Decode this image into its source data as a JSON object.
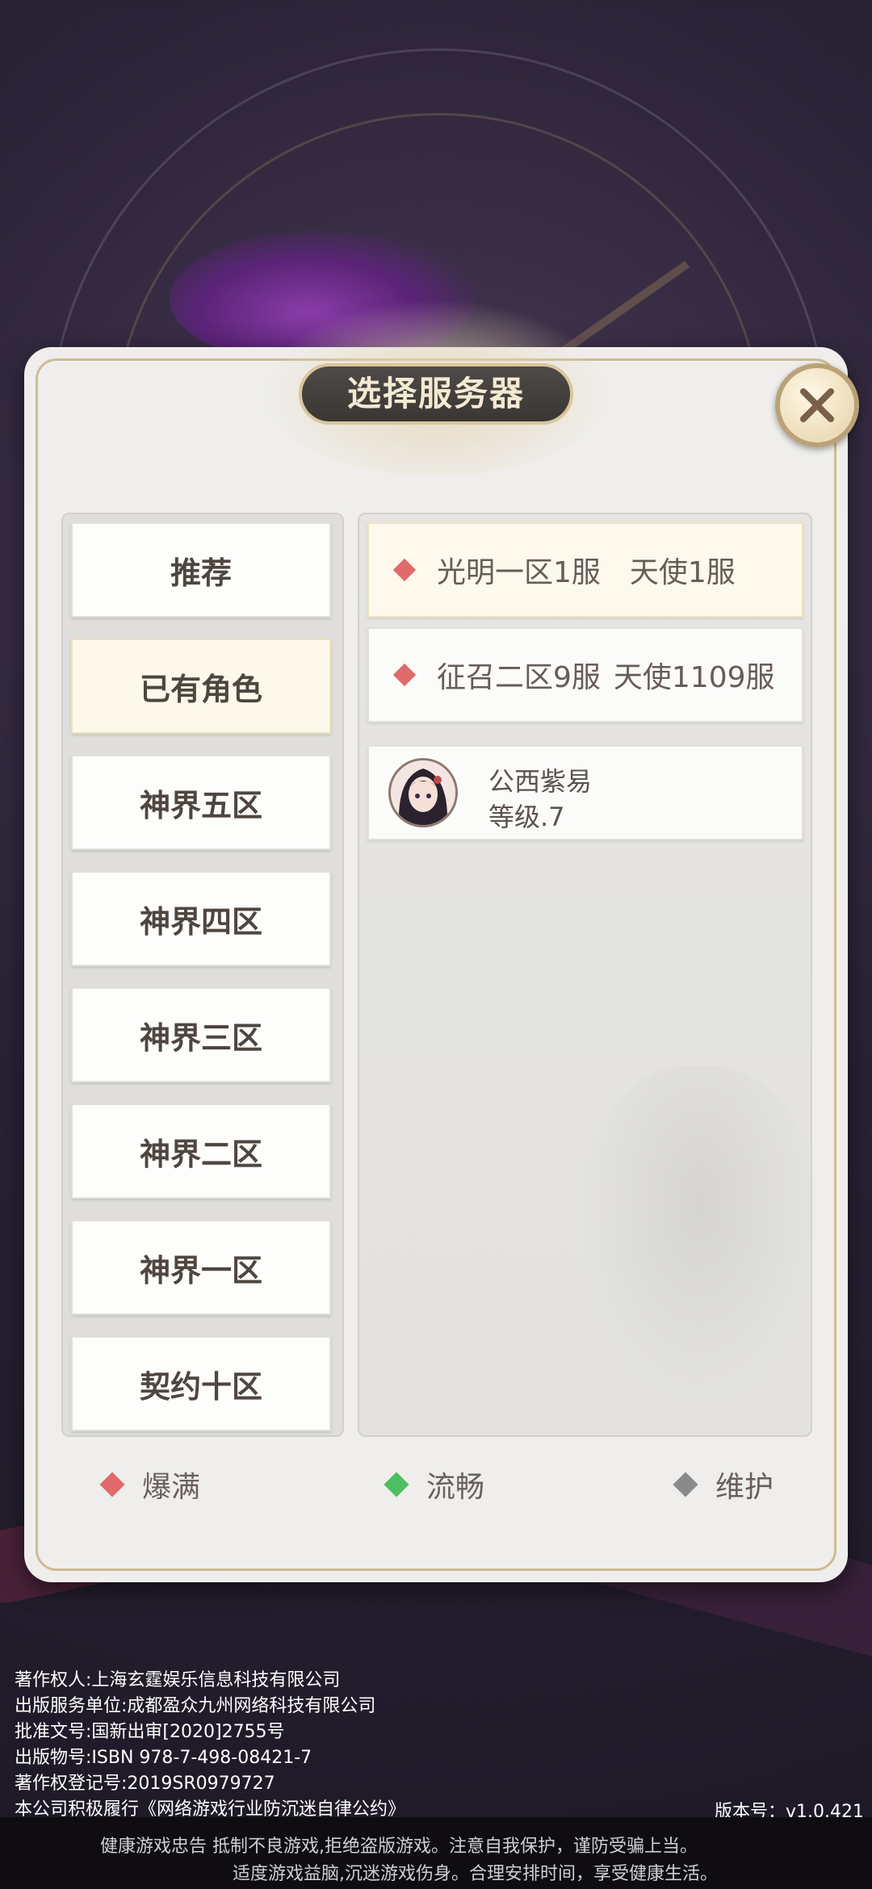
{
  "dialog": {
    "title": "选择服务器"
  },
  "regions": [
    {
      "label": "推荐",
      "selected": false
    },
    {
      "label": "已有角色",
      "selected": true
    },
    {
      "label": "神界五区",
      "selected": false
    },
    {
      "label": "神界四区",
      "selected": false
    },
    {
      "label": "神界三区",
      "selected": false
    },
    {
      "label": "神界二区",
      "selected": false
    },
    {
      "label": "神界一区",
      "selected": false
    },
    {
      "label": "契约十区",
      "selected": false
    }
  ],
  "servers": [
    {
      "name": "光明一区1服",
      "sub": "天使1服",
      "status": "爆满"
    },
    {
      "name": "征召二区9服",
      "sub": "天使1109服",
      "status": "爆满"
    }
  ],
  "character": {
    "name": "公西紫易",
    "level": "等级.7"
  },
  "legend": [
    {
      "label": "爆满",
      "color": "#e06a6c"
    },
    {
      "label": "流畅",
      "color": "#4cbf63"
    },
    {
      "label": "维护",
      "color": "#8a8a8a"
    }
  ],
  "footer": {
    "copyright_lines": [
      "著作权人:上海玄霆娱乐信息科技有限公司",
      "出版服务单位:成都盈众九州网络科技有限公司",
      "批准文号:国新出审[2020]2755号",
      "出版物号:ISBN 978-7-498-08421-7",
      "著作权登记号:2019SR0979727",
      "本公司积极履行《网络游戏行业防沉迷自律公约》"
    ],
    "version": "版本号：v1.0.421",
    "health_line1": "健康游戏忠告    抵制不良游戏,拒绝盗版游戏。注意自我保护，谨防受骗上当。",
    "health_line2": "适度游戏益脑,沉迷游戏伤身。合理安排时间，享受健康生活。"
  },
  "icons": {
    "close": "close-x-icon",
    "status_marker": "diamond-icon",
    "avatar": "character-avatar"
  }
}
